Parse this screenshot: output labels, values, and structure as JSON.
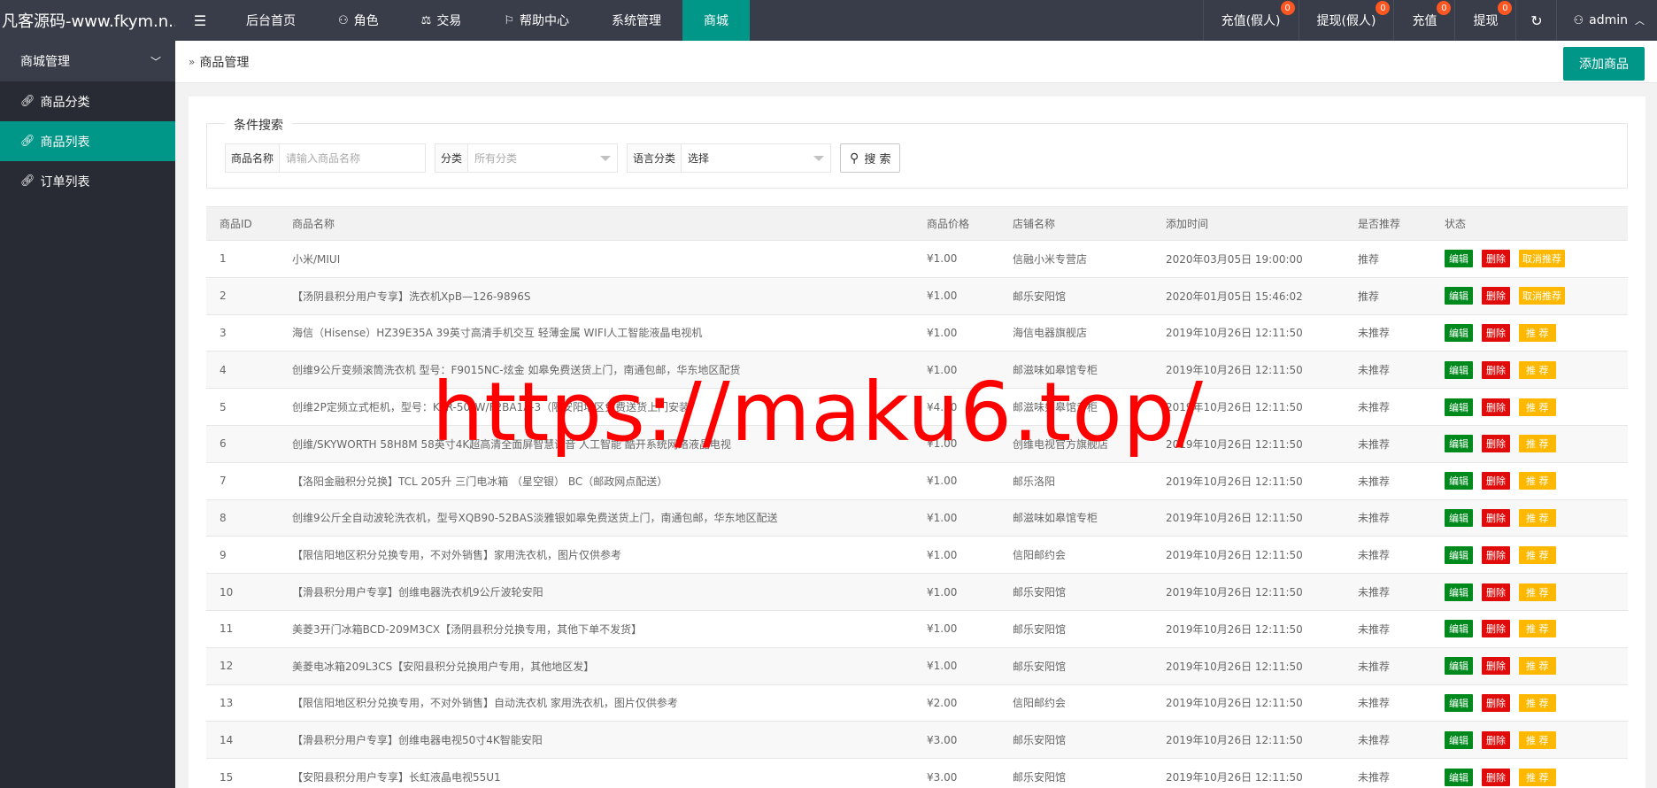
{
  "app": {
    "brand": "凡客源码-www.fkym.n...",
    "watermark": "https://maku6.top/"
  },
  "topnav": {
    "items": [
      {
        "label": "后台首页",
        "icon": ""
      },
      {
        "label": "角色",
        "icon": "user-icon"
      },
      {
        "label": "交易",
        "icon": "scale-icon"
      },
      {
        "label": "帮助中心",
        "icon": "flag-icon"
      },
      {
        "label": "系统管理",
        "icon": ""
      },
      {
        "label": "商城",
        "icon": "",
        "active": true
      }
    ],
    "right": [
      {
        "label": "充值(假人)",
        "badge": "0"
      },
      {
        "label": "提现(假人)",
        "badge": "0"
      },
      {
        "label": "充值",
        "badge": "0"
      },
      {
        "label": "提现",
        "badge": "0"
      }
    ],
    "user": "admin"
  },
  "sidebar": {
    "group": "商城管理",
    "items": [
      {
        "label": "商品分类"
      },
      {
        "label": "商品列表",
        "active": true
      },
      {
        "label": "订单列表"
      }
    ]
  },
  "page": {
    "breadcrumb": "商品管理",
    "add_button": "添加商品"
  },
  "search": {
    "legend": "条件搜索",
    "name_label": "商品名称",
    "name_placeholder": "请输入商品名称",
    "category_label": "分类",
    "category_placeholder": "所有分类",
    "lang_label": "语言分类",
    "lang_value": "选择",
    "search_button": "搜 索"
  },
  "table": {
    "columns": [
      "商品ID",
      "商品名称",
      "商品价格",
      "店铺名称",
      "添加时间",
      "是否推荐",
      "状态"
    ],
    "actions": {
      "edit": "编辑",
      "delete": "删除",
      "recommend": "推 荐",
      "cancel_recommend": "取消推荐"
    },
    "rows": [
      {
        "id": "1",
        "name": "小米/MIUI",
        "price": "¥1.00",
        "shop": "信融小米专营店",
        "time": "2020年03月05日 19:00:00",
        "rec": "推荐",
        "recommended": true
      },
      {
        "id": "2",
        "name": "【汤阴县积分用户专享】洗衣机XpB—126-9896S",
        "price": "¥1.00",
        "shop": "邮乐安阳馆",
        "time": "2020年01月05日 15:46:02",
        "rec": "推荐",
        "recommended": true
      },
      {
        "id": "3",
        "name": "海信（Hisense）HZ39E35A 39英寸高清手机交互 轻薄金属 WIFI人工智能液晶电视机",
        "price": "¥1.00",
        "shop": "海信电器旗舰店",
        "time": "2019年10月26日 12:11:50",
        "rec": "未推荐",
        "recommended": false
      },
      {
        "id": "4",
        "name": "创维9公斤变频滚筒洗衣机 型号：F9015NC-炫金 如皋免费送货上门，南通包邮，华东地区配货",
        "price": "¥1.00",
        "shop": "邮滋味如皋馆专柜",
        "time": "2019年10月26日 12:11:50",
        "rec": "未推荐",
        "recommended": false
      },
      {
        "id": "5",
        "name": "创维2P定频立式柜机，型号：KFR-50LW/F2BA1A-3（限安阳地区免费送货上门安装）",
        "price": "¥4.00",
        "shop": "邮滋味如皋馆专柜",
        "time": "2019年10月26日 12:11:50",
        "rec": "未推荐",
        "recommended": false
      },
      {
        "id": "6",
        "name": "创维/SKYWORTH 58H8M 58英寸4K超高清全面屏智慧语音 人工智能 酷开系统网络液晶电视",
        "price": "¥1.00",
        "shop": "创维电视官方旗舰店",
        "time": "2019年10月26日 12:11:50",
        "rec": "未推荐",
        "recommended": false
      },
      {
        "id": "7",
        "name": "【洛阳金融积分兑换】TCL 205升 三门电冰箱 （星空银） BC（邮政网点配送）",
        "price": "¥1.00",
        "shop": "邮乐洛阳",
        "time": "2019年10月26日 12:11:50",
        "rec": "未推荐",
        "recommended": false
      },
      {
        "id": "8",
        "name": "创维9公斤全自动波轮洗衣机，型号XQB90-52BAS淡雅银如皋免费送货上门，南通包邮，华东地区配送",
        "price": "¥1.00",
        "shop": "邮滋味如皋馆专柜",
        "time": "2019年10月26日 12:11:50",
        "rec": "未推荐",
        "recommended": false
      },
      {
        "id": "9",
        "name": "【限信阳地区积分兑换专用，不对外销售】家用洗衣机，图片仅供参考",
        "price": "¥1.00",
        "shop": "信阳邮约会",
        "time": "2019年10月26日 12:11:50",
        "rec": "未推荐",
        "recommended": false
      },
      {
        "id": "10",
        "name": "【滑县积分用户专享】创维电器洗衣机9公斤波轮安阳",
        "price": "¥1.00",
        "shop": "邮乐安阳馆",
        "time": "2019年10月26日 12:11:50",
        "rec": "未推荐",
        "recommended": false
      },
      {
        "id": "11",
        "name": "美菱3开门冰箱BCD-209M3CX【汤阴县积分兑换专用，其他下单不发货】",
        "price": "¥1.00",
        "shop": "邮乐安阳馆",
        "time": "2019年10月26日 12:11:50",
        "rec": "未推荐",
        "recommended": false
      },
      {
        "id": "12",
        "name": "美菱电冰箱209L3CS【安阳县积分兑换用户专用，其他地区发】",
        "price": "¥1.00",
        "shop": "邮乐安阳馆",
        "time": "2019年10月26日 12:11:50",
        "rec": "未推荐",
        "recommended": false
      },
      {
        "id": "13",
        "name": "【限信阳地区积分兑换专用，不对外销售】自动洗衣机 家用洗衣机，图片仅供参考",
        "price": "¥2.00",
        "shop": "信阳邮约会",
        "time": "2019年10月26日 12:11:50",
        "rec": "未推荐",
        "recommended": false
      },
      {
        "id": "14",
        "name": "【滑县积分用户专享】创维电器电视50寸4K智能安阳",
        "price": "¥3.00",
        "shop": "邮乐安阳馆",
        "time": "2019年10月26日 12:11:50",
        "rec": "未推荐",
        "recommended": false
      },
      {
        "id": "15",
        "name": "【安阳县积分用户专享】长虹液晶电视55U1",
        "price": "¥3.00",
        "shop": "邮乐安阳馆",
        "time": "2019年10月26日 12:11:50",
        "rec": "未推荐",
        "recommended": false
      }
    ]
  },
  "colors": {
    "topbar": "#393d49",
    "sidebar": "#282b33",
    "accent": "#009688",
    "edit": "#008a1e",
    "delete": "#e00b0b",
    "recommend": "#ffb800",
    "badge": "#ff5722",
    "watermark": "#ff0000"
  }
}
